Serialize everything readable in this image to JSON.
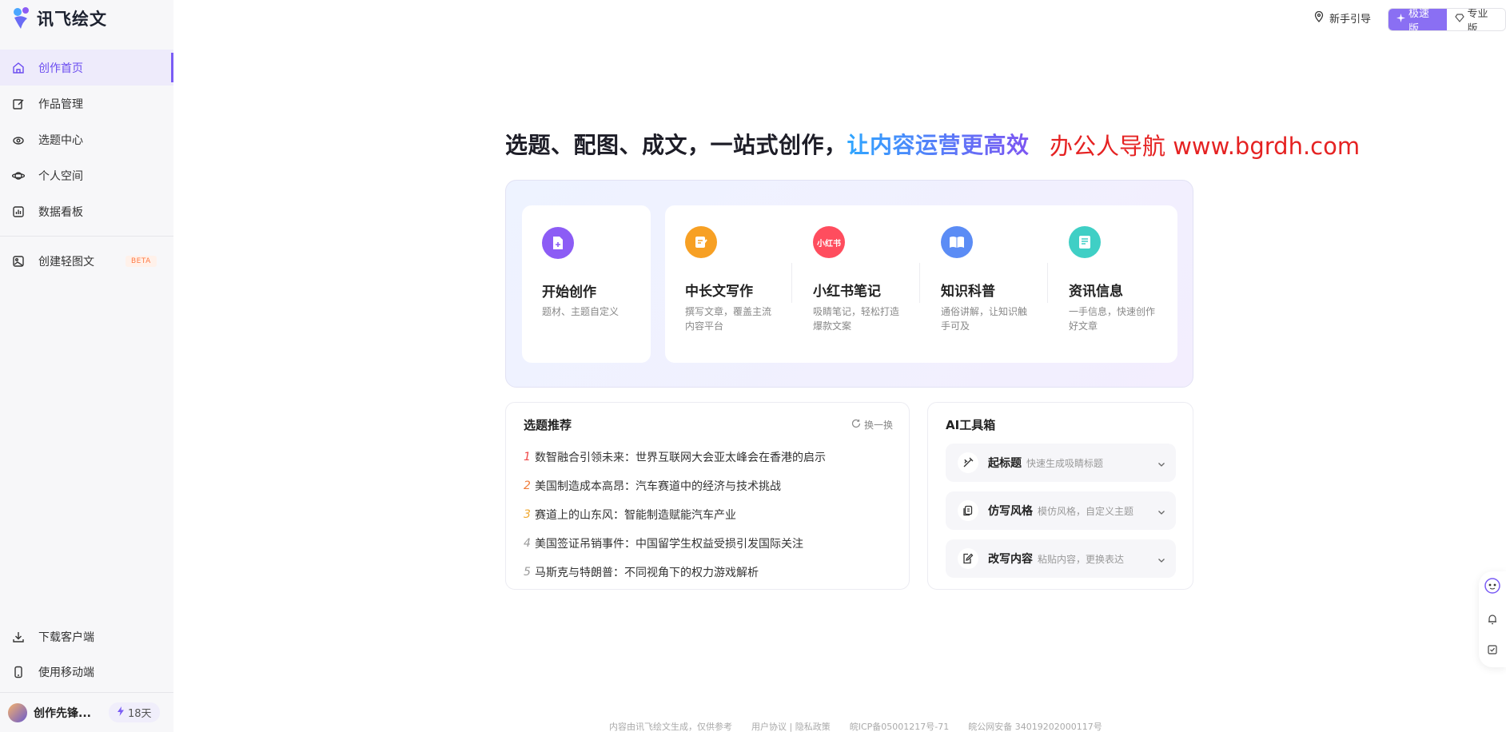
{
  "app": {
    "logo_text": "讯飞绘文"
  },
  "sidebar": {
    "items": [
      {
        "label": "创作首页",
        "icon": "home-icon",
        "active": true
      },
      {
        "label": "作品管理",
        "icon": "edit-icon"
      },
      {
        "label": "选题中心",
        "icon": "eye-icon"
      },
      {
        "label": "个人空间",
        "icon": "planet-icon"
      },
      {
        "label": "数据看板",
        "icon": "chart-icon"
      }
    ],
    "light_post": {
      "label": "创建轻图文",
      "icon": "image-icon",
      "badge": "BETA"
    },
    "bottom_items": [
      {
        "label": "下载客户端",
        "icon": "download-icon"
      },
      {
        "label": "使用移动端",
        "icon": "mobile-icon"
      }
    ],
    "user": {
      "name": "创作先锋...",
      "days": "18天"
    }
  },
  "header": {
    "guide": "新手引导",
    "versions": [
      {
        "label": "极速版",
        "active": true
      },
      {
        "label": "专业版",
        "active": false
      }
    ]
  },
  "hero": {
    "headline_main": "选题、配图、成文，一站式创作，",
    "headline_highlight": "让内容运营更高效",
    "watermark": "办公人导航 www.bgrdh.com"
  },
  "create": {
    "start": {
      "title": "开始创作",
      "desc": "题材、主题自定义",
      "color": "#8c5cf5"
    },
    "types": [
      {
        "title": "中长文写作",
        "desc": "撰写文章，覆盖主流内容平台",
        "color": "#f7a024"
      },
      {
        "title": "小红书笔记",
        "desc": "吸睛笔记，轻松打造爆款文案",
        "color": "#ff4d5e",
        "icon_text": "小红书"
      },
      {
        "title": "知识科普",
        "desc": "通俗讲解，让知识触手可及",
        "color": "#5b8cf5"
      },
      {
        "title": "资讯信息",
        "desc": "一手信息，快速创作好文章",
        "color": "#3fcfc5"
      }
    ]
  },
  "topics": {
    "title": "选题推荐",
    "refresh": "换一换",
    "items": [
      {
        "num": "1",
        "text": "数智融合引领未来：世界互联网大会亚太峰会在香港的启示",
        "color": "#f04848"
      },
      {
        "num": "2",
        "text": "美国制造成本高昂：汽车赛道中的经济与技术挑战",
        "color": "#f07d3c"
      },
      {
        "num": "3",
        "text": "赛道上的山东风：智能制造赋能汽车产业",
        "color": "#f0a830"
      },
      {
        "num": "4",
        "text": "美国签证吊销事件：中国留学生权益受损引发国际关注",
        "color": "#999999"
      },
      {
        "num": "5",
        "text": "马斯克与特朗普：不同视角下的权力游戏解析",
        "color": "#999999"
      }
    ]
  },
  "ai_tools": {
    "title": "AI工具箱",
    "items": [
      {
        "name": "起标题",
        "desc": "快速生成吸睛标题",
        "icon": "title-wand-icon"
      },
      {
        "name": "仿写风格",
        "desc": "模仿风格，自定义主题",
        "icon": "copy-style-icon"
      },
      {
        "name": "改写内容",
        "desc": "粘贴内容，更换表达",
        "icon": "rewrite-icon"
      }
    ]
  },
  "footer": {
    "items": [
      "内容由讯飞绘文生成，仅供参考",
      "用户协议 | 隐私政策",
      "皖ICP备05001217号-71",
      "皖公网安备 34019202000117号"
    ]
  }
}
